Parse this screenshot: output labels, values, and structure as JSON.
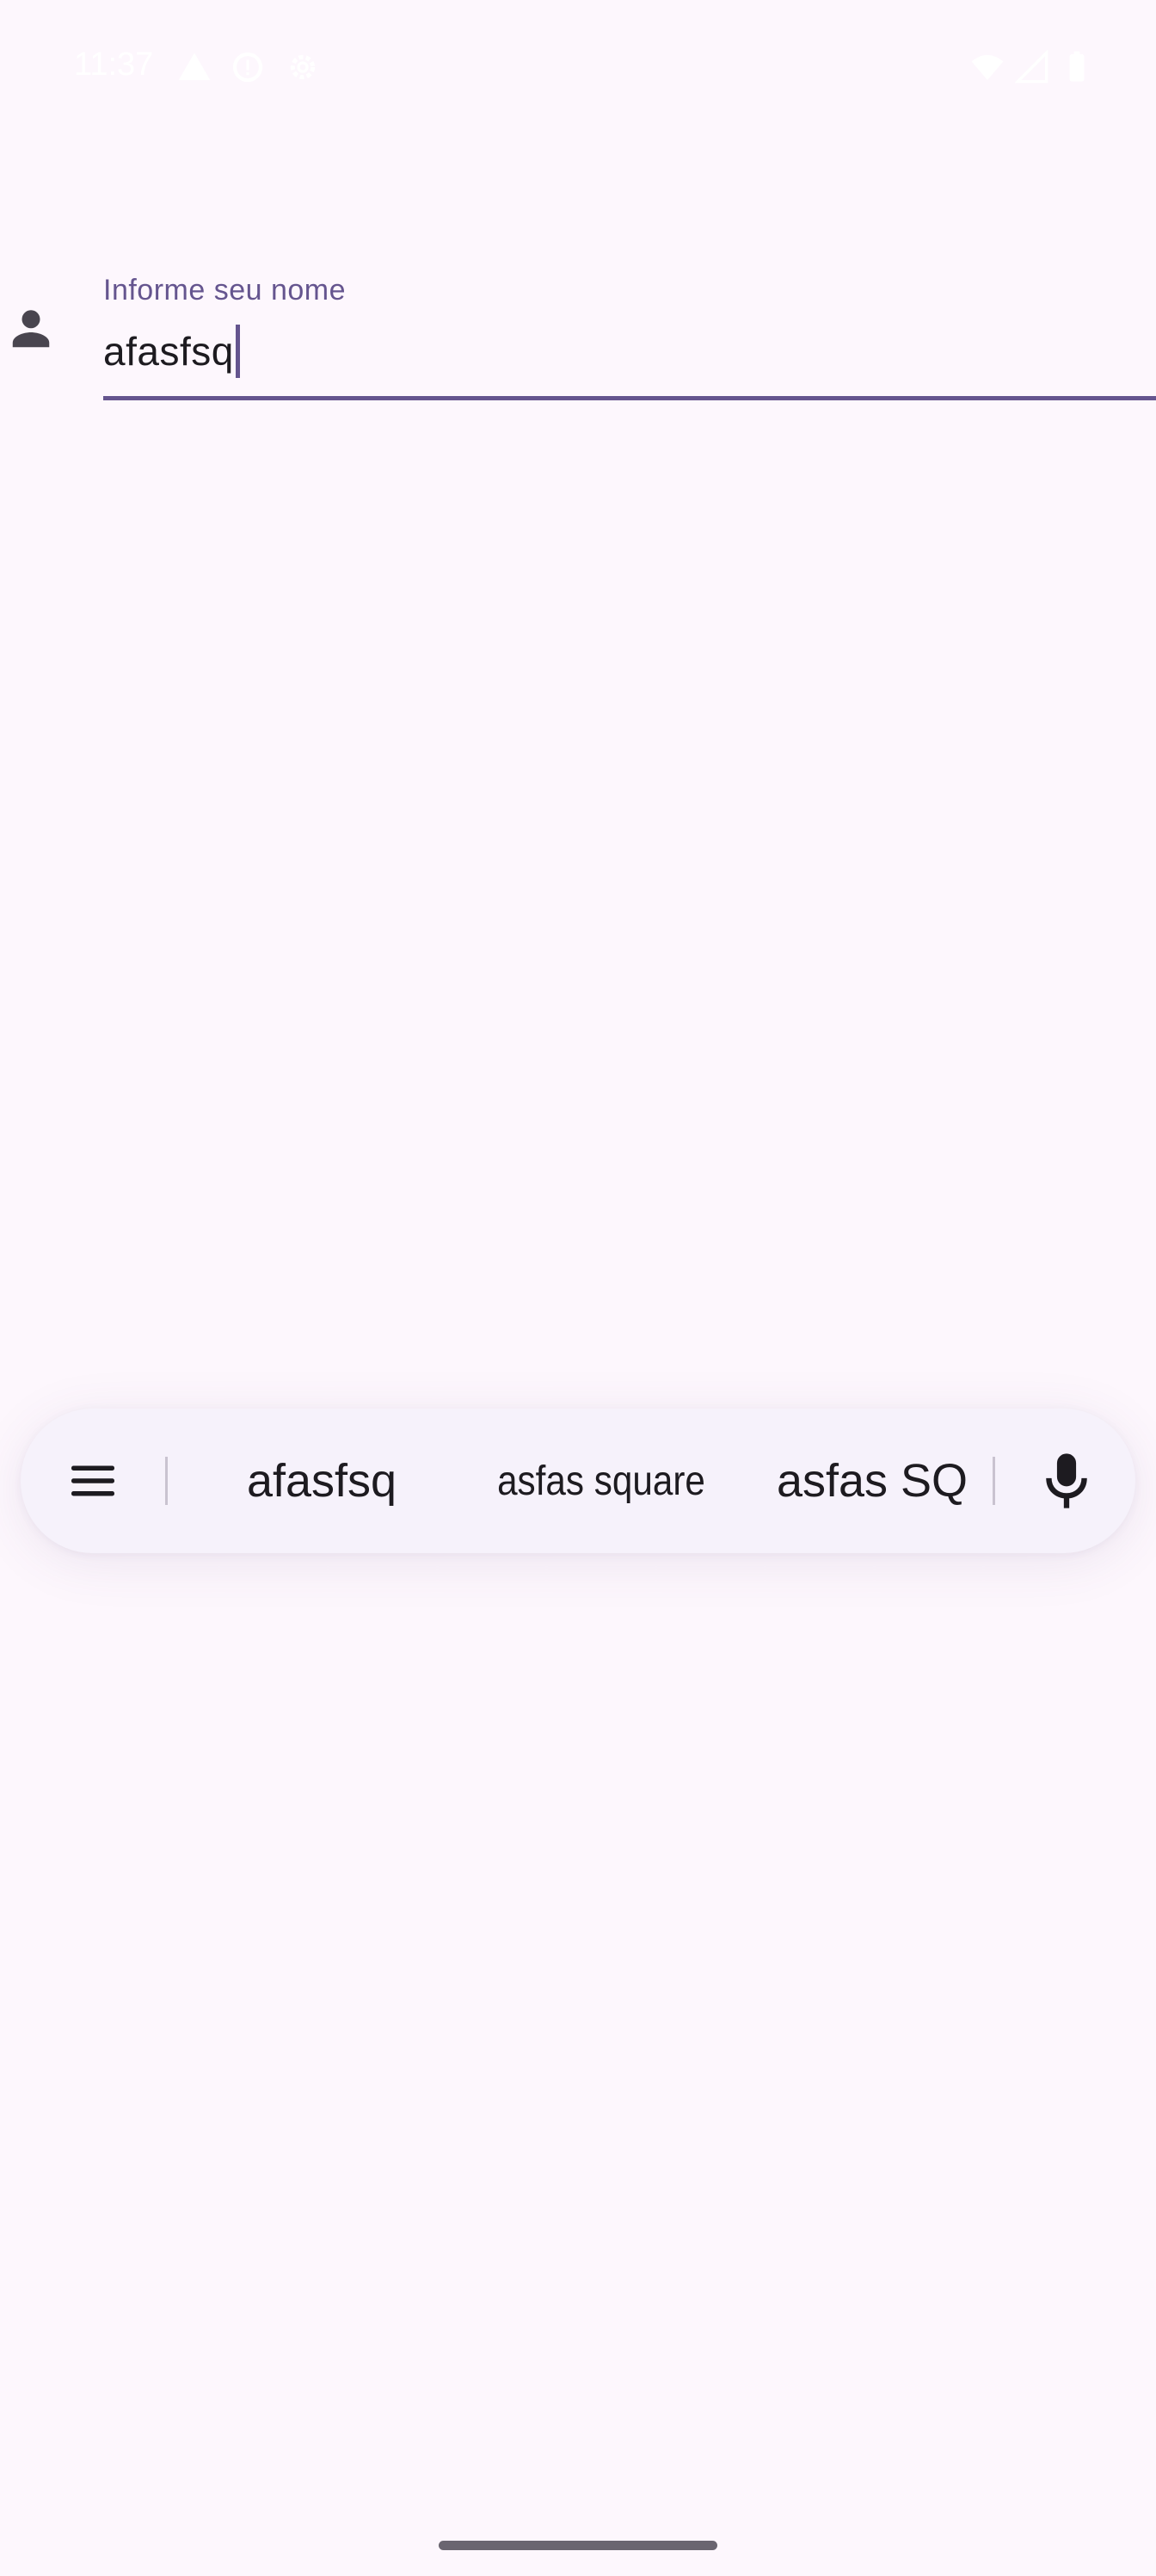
{
  "status_bar": {
    "time": "11:37",
    "icons": [
      "warning-icon",
      "info-icon",
      "settings-icon",
      "wifi-icon",
      "signal-icon",
      "battery-icon"
    ]
  },
  "form": {
    "name_field": {
      "label": "Informe seu nome",
      "value": "afasfsq",
      "icon": "person-icon"
    }
  },
  "keyboard": {
    "suggestions": [
      "afasfsq",
      "asfas square",
      "asfas SQ"
    ],
    "left_icon": "menu-icon",
    "right_icon": "microphone-icon"
  },
  "colors": {
    "background": "#fdf7fd",
    "accent": "#65558f",
    "suggestion_bar": "#f6f2fb",
    "text": "#1d1b20"
  }
}
